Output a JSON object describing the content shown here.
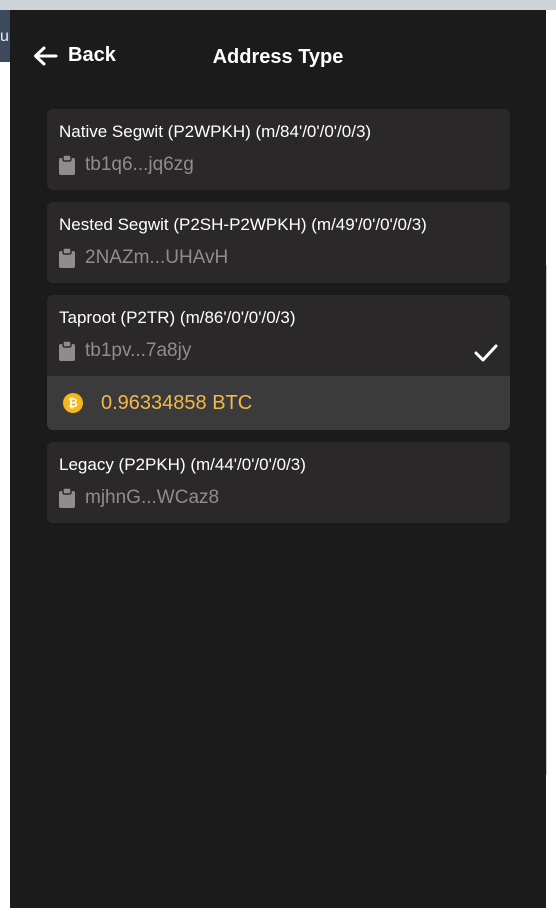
{
  "header": {
    "back_label": "Back",
    "title": "Address Type"
  },
  "address_types": [
    {
      "label": "Native Segwit (P2WPKH) (m/84'/0'/0'/0/3)",
      "address": "tb1q6...jq6zg",
      "selected": false
    },
    {
      "label": "Nested Segwit (P2SH-P2WPKH) (m/49'/0'/0'/0/3)",
      "address": "2NAZm...UHAvH",
      "selected": false
    },
    {
      "label": "Taproot (P2TR) (m/86'/0'/0'/0/3)",
      "address": "tb1pv...7a8jy",
      "selected": true,
      "balance": "0.96334858 BTC"
    },
    {
      "label": "Legacy (P2PKH) (m/44'/0'/0'/0/3)",
      "address": "mjhnG...WCaz8",
      "selected": false
    }
  ],
  "background_text": "ur",
  "icons": {
    "back": "arrow-left-icon",
    "copy": "clipboard-icon",
    "selected": "checkmark-icon",
    "coin": "bitcoin-icon"
  },
  "colors": {
    "panel_bg": "#1c1b1b",
    "card_bg": "#2a2828",
    "balance_bg": "#3c3b3b",
    "balance_text": "#f2b84b",
    "bitcoin_orange": "#f7b61c",
    "muted_text": "#8f8c8c"
  }
}
